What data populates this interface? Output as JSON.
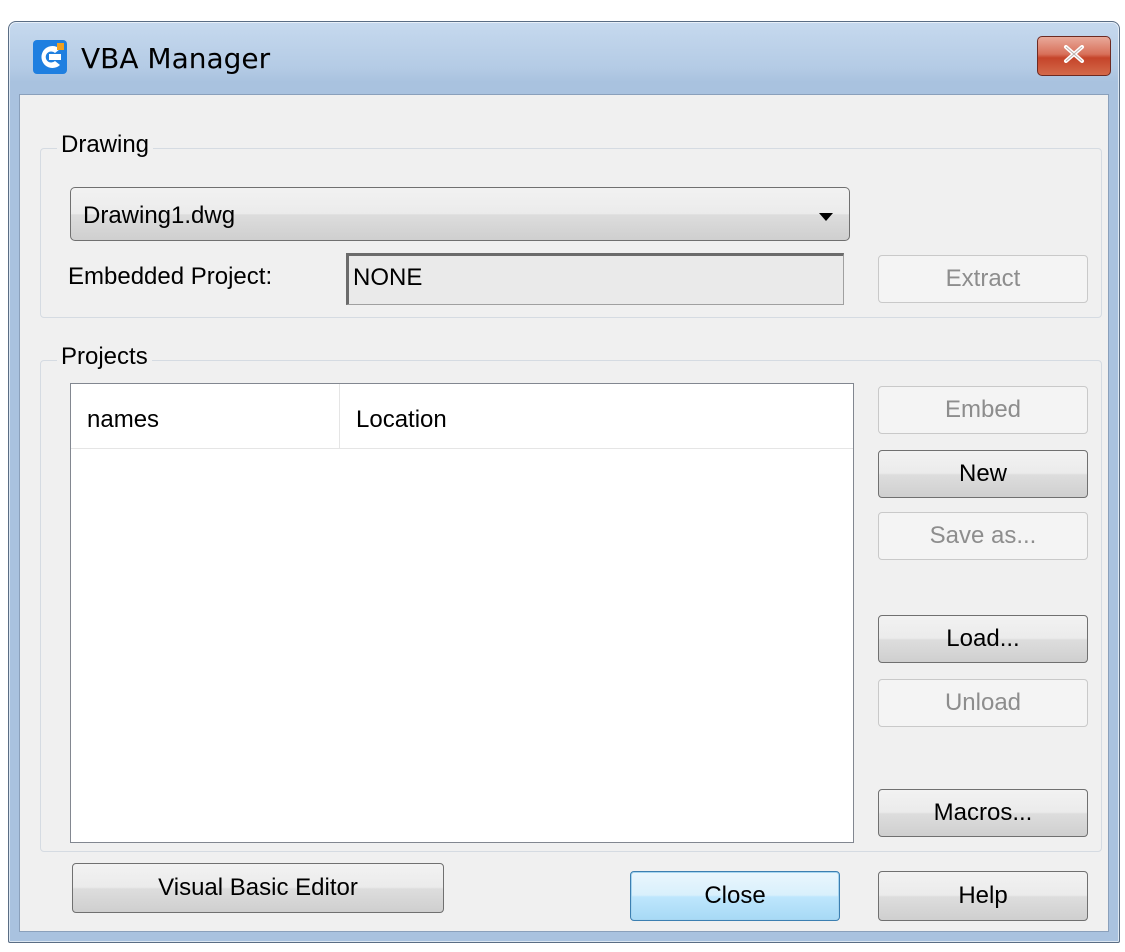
{
  "window": {
    "title": "VBA Manager",
    "icon": "app-logo-icon",
    "close_icon": "close-icon"
  },
  "drawing": {
    "group_label": "Drawing",
    "selected_drawing": "Drawing1.dwg",
    "embedded_project_label": "Embedded Project:",
    "embedded_project_value": "NONE",
    "extract_label": "Extract"
  },
  "projects": {
    "group_label": "Projects",
    "columns": [
      "names",
      "Location"
    ],
    "rows": [],
    "embed_label": "Embed",
    "new_label": "New",
    "save_as_label": "Save as...",
    "load_label": "Load...",
    "unload_label": "Unload",
    "macros_label": "Macros..."
  },
  "footer": {
    "vbe_label": "Visual Basic Editor",
    "close_label": "Close",
    "help_label": "Help"
  },
  "colors": {
    "titlebar": "#b4cbe5",
    "close_button": "#c5442a",
    "dialog_bg": "#f0f0f0",
    "default_button": "#bee6fd"
  }
}
